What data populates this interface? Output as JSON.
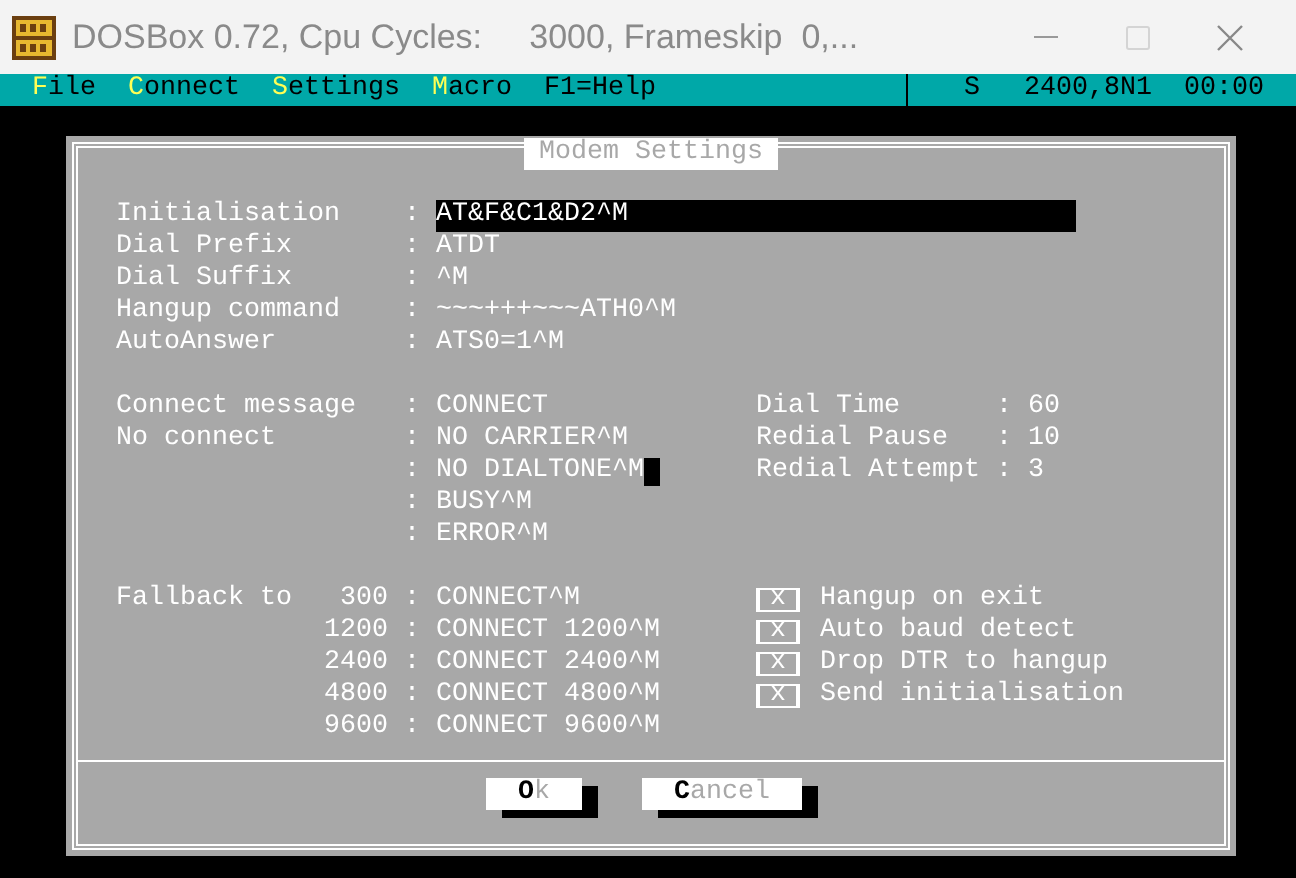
{
  "window": {
    "title": "DOSBox 0.72, Cpu Cycles:     3000, Frameskip  0,...",
    "maximize_disabled": true
  },
  "menu": [
    {
      "label": "File",
      "hotkey": true
    },
    {
      "label": "Connect",
      "hotkey": true
    },
    {
      "label": "Settings",
      "hotkey": true
    },
    {
      "label": "Macro",
      "hotkey": true
    },
    {
      "label": "F1=Help",
      "hotkey": false
    }
  ],
  "status": [
    "S",
    "2400,8N1",
    "00:00"
  ],
  "dialog": {
    "title": "Modem Settings",
    "commands": [
      {
        "label": "Initialisation",
        "colon": ":",
        "value": "AT&F&C1&D2^M",
        "focused": true
      },
      {
        "label": "Dial Prefix",
        "colon": ":",
        "value": "ATDT",
        "focused": false
      },
      {
        "label": "Dial Suffix",
        "colon": ":",
        "value": "^M",
        "focused": false
      },
      {
        "label": "Hangup command",
        "colon": ":",
        "value": "~~~+++~~~ATH0^M",
        "focused": false
      },
      {
        "label": "AutoAnswer",
        "colon": ":",
        "value": "ATS0=1^M",
        "focused": false
      }
    ],
    "messages": [
      {
        "label": "Connect message",
        "colon": ":",
        "value": "CONNECT",
        "cursor": false
      },
      {
        "label": "No connect",
        "colon": ":",
        "value": "NO CARRIER^M",
        "cursor": false
      },
      {
        "colon": ":",
        "value": "NO DIALTONE^M",
        "cursor": true
      },
      {
        "colon": ":",
        "value": "BUSY^M",
        "cursor": false
      },
      {
        "colon": ":",
        "value": "ERROR^M",
        "cursor": false
      }
    ],
    "timing": [
      {
        "label": "Dial Time",
        "colon": ":",
        "value": "60"
      },
      {
        "label": "Redial Pause",
        "colon": ":",
        "value": "10"
      },
      {
        "label": "Redial Attempt",
        "colon": ":",
        "value": "3"
      }
    ],
    "fallback": {
      "label": "Fallback to",
      "rows": [
        {
          "rate": "300",
          "colon": ":",
          "value": "CONNECT^M"
        },
        {
          "rate": "1200",
          "colon": ":",
          "value": "CONNECT 1200^M"
        },
        {
          "rate": "2400",
          "colon": ":",
          "value": "CONNECT 2400^M"
        },
        {
          "rate": "4800",
          "colon": ":",
          "value": "CONNECT 4800^M"
        },
        {
          "rate": "9600",
          "colon": ":",
          "value": "CONNECT 9600^M"
        }
      ]
    },
    "options": [
      {
        "glyph": "x",
        "label": "Hangup on exit",
        "checked": true
      },
      {
        "glyph": "x",
        "label": "Auto baud detect",
        "checked": true
      },
      {
        "glyph": "x",
        "label": "Drop DTR to hangup",
        "checked": true
      },
      {
        "glyph": "x",
        "label": "Send initialisation",
        "checked": true
      }
    ],
    "buttons": [
      {
        "label": "Ok"
      },
      {
        "label": "Cancel"
      }
    ]
  }
}
